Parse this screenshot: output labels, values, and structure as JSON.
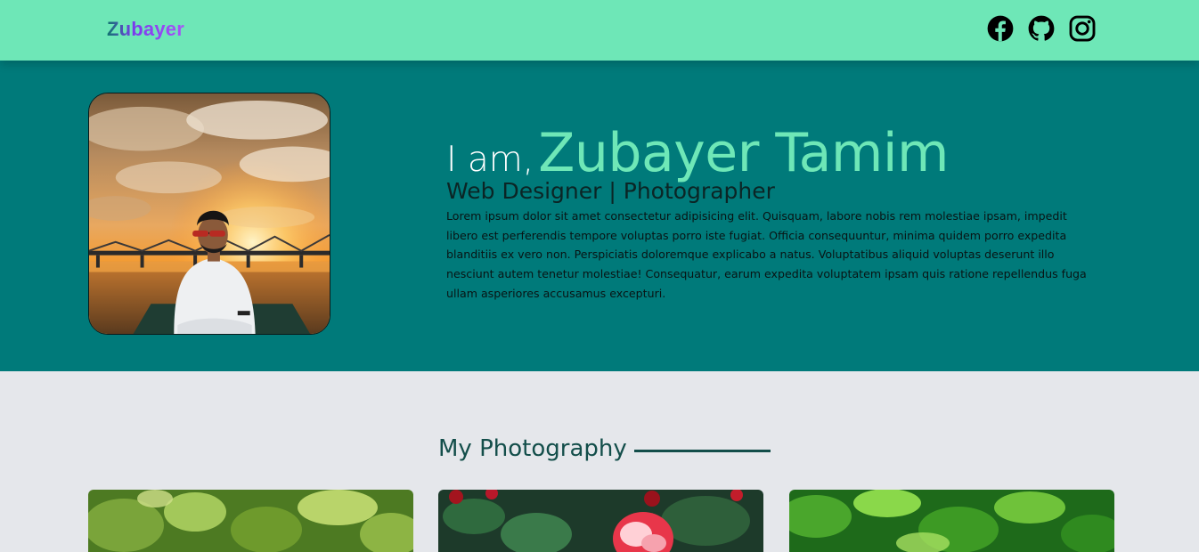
{
  "navbar": {
    "brand": "Zubayer",
    "socials": [
      {
        "icon": "facebook-icon",
        "name": "Facebook"
      },
      {
        "icon": "github-icon",
        "name": "GitHub"
      },
      {
        "icon": "instagram-icon",
        "name": "Instagram"
      }
    ]
  },
  "hero": {
    "greeting": "I am,",
    "name": "Zubayer Tamim",
    "role": "Web Designer | Photographer",
    "bio": "Lorem ipsum dolor sit amet consectetur adipisicing elit. Quisquam, labore nobis rem molestiae ipsam, impedit libero est perferendis tempore voluptas porro iste fugiat. Officia consequuntur, minima quidem porro expedita blanditiis ex vero non. Perspiciatis doloremque explicabo a natus. Voluptatibus aliquid voluptas deserunt illo nesciunt autem tenetur molestiae! Consequatur, earum expedita voluptatem ipsam quis ratione repellendus fuga ullam asperiores accusamus excepturi."
  },
  "photography": {
    "title": "My Photography"
  },
  "colors": {
    "navbar": "#6ee7b7",
    "hero": "#007a7a",
    "accent": "#6ee7b7",
    "page": "#e5e7eb",
    "section_title": "#134e4a"
  }
}
